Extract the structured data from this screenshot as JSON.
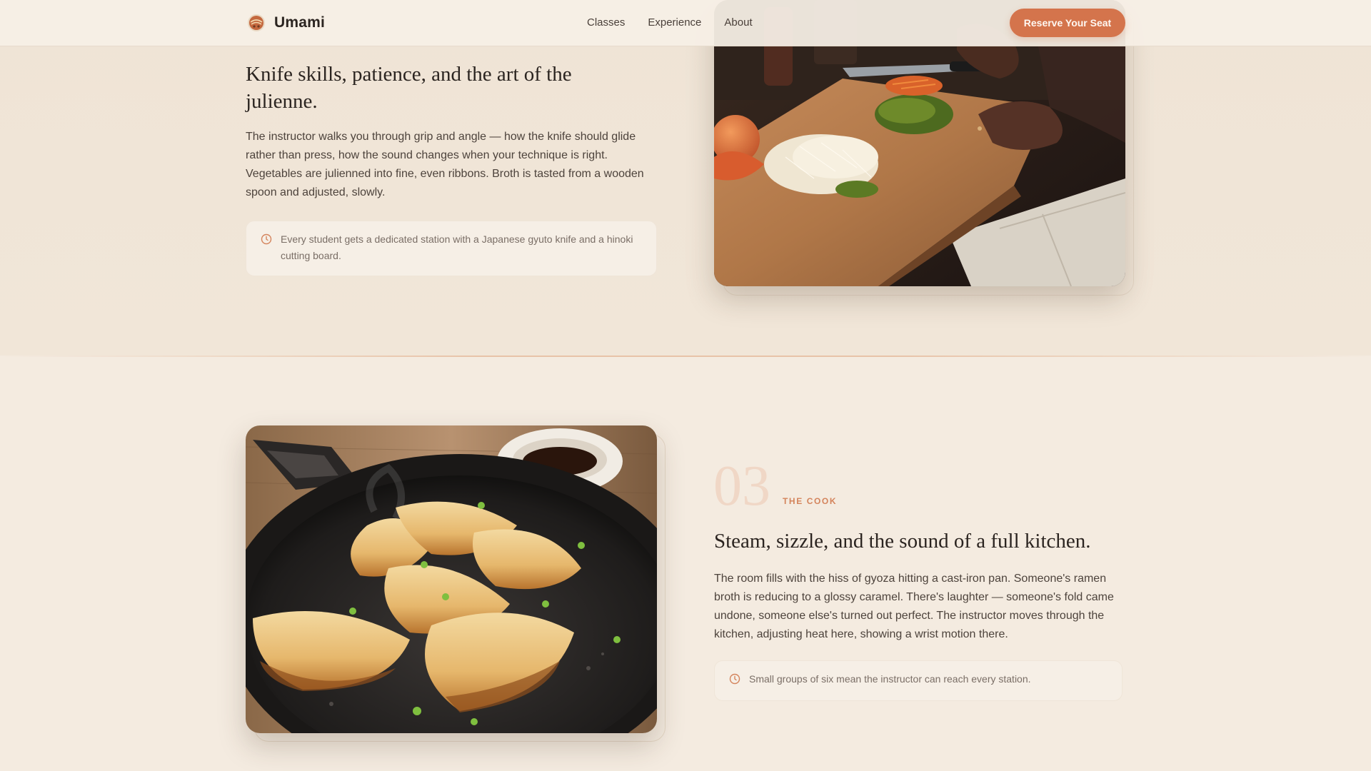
{
  "header": {
    "brand": "Umami",
    "logo_icon": "bowl-icon",
    "nav": [
      "Classes",
      "Experience",
      "About"
    ],
    "cta_label": "Reserve Your Seat"
  },
  "colors": {
    "accent": "#d4744c",
    "background": "#f4ebe0",
    "step_number": "#f0d7c6",
    "step_label": "#d4845c",
    "heading": "#2b2420"
  },
  "section_knife": {
    "heading": "Knife skills, patience, and the art of the julienne.",
    "body": "The instructor walks you through grip and angle — how the knife should glide rather than press, how the sound changes when your technique is right. Vegetables are julienned into fine, even ribbons. Broth is tasted from a wooden spoon and adjusted, slowly.",
    "note_icon": "clock-icon",
    "note": "Every student gets a dedicated station with a Japanese gyuto knife and a hinoki cutting board."
  },
  "section_cook": {
    "step_number": "03",
    "step_label": "THE COOK",
    "heading": "Steam, sizzle, and the sound of a full kitchen.",
    "body": "The room fills with the hiss of gyoza hitting a cast-iron pan. Someone's ramen broth is reducing to a glossy caramel. There's laughter — someone's fold came undone, someone else's turned out perfect. The instructor moves through the kitchen, adjusting heat here, showing a wrist motion there.",
    "note_icon": "clock-icon",
    "note": "Small groups of six mean the instructor can reach every station."
  }
}
